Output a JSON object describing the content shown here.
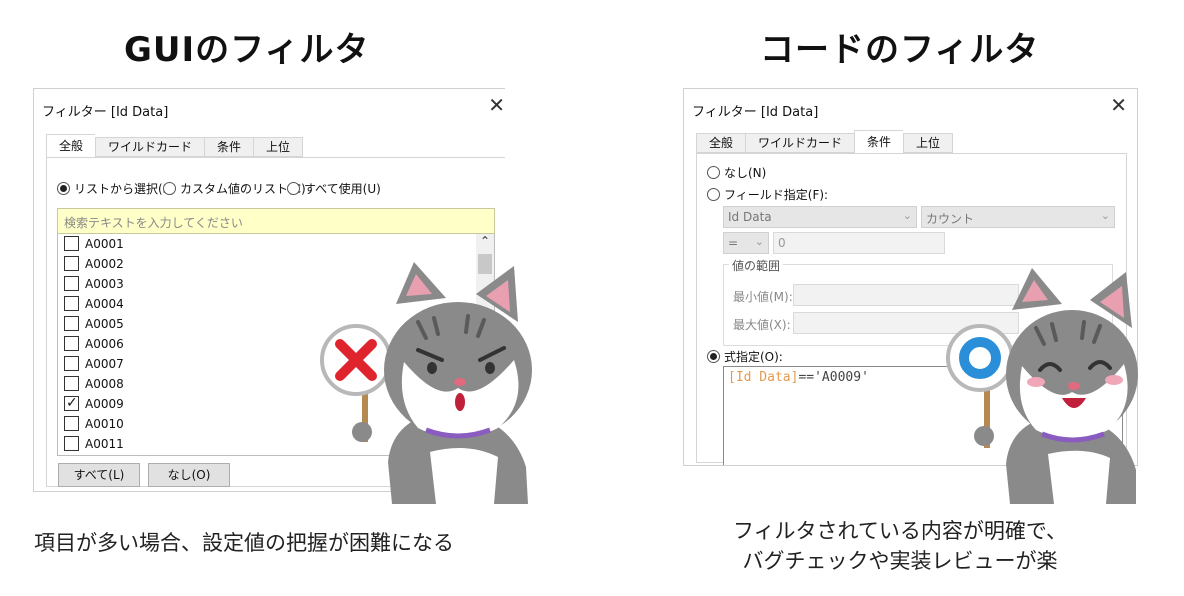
{
  "headings": {
    "left": "GUIのフィルタ",
    "right": "コードのフィルタ"
  },
  "captions": {
    "left": "項目が多い場合、設定値の把握が困難になる",
    "right_line1": "フィルタされている内容が明確で、",
    "right_line2": "バグチェックや実装レビューが楽"
  },
  "dialog_left": {
    "title": "フィルター [Id Data]",
    "close": "✕",
    "tabs": [
      "全般",
      "ワイルドカード",
      "条件",
      "上位"
    ],
    "radios": [
      "リストから選択(S)",
      "カスタム値のリスト(C)",
      "すべて使用(U)"
    ],
    "search_placeholder": "検索テキストを入力してください",
    "items": [
      {
        "label": "A0001",
        "checked": false
      },
      {
        "label": "A0002",
        "checked": false
      },
      {
        "label": "A0003",
        "checked": false
      },
      {
        "label": "A0004",
        "checked": false
      },
      {
        "label": "A0005",
        "checked": false
      },
      {
        "label": "A0006",
        "checked": false
      },
      {
        "label": "A0007",
        "checked": false
      },
      {
        "label": "A0008",
        "checked": false
      },
      {
        "label": "A0009",
        "checked": true
      },
      {
        "label": "A0010",
        "checked": false
      },
      {
        "label": "A0011",
        "checked": false
      }
    ],
    "btn_all": "すべて(L)",
    "btn_none": "なし(O)"
  },
  "dialog_right": {
    "title": "フィルター [Id Data]",
    "close": "✕",
    "tabs": [
      "全般",
      "ワイルドカード",
      "条件",
      "上位"
    ],
    "radio_none": "なし(N)",
    "radio_field": "フィールド指定(F):",
    "field_select": "Id Data",
    "agg_select": "カウント",
    "op_select": "=",
    "value": "0",
    "range_legend": "値の範囲",
    "min_label": "最小値(M):",
    "max_label": "最大値(X):",
    "radio_expr": "式指定(O):",
    "expr_field": "[Id Data]",
    "expr_rest": "=='A0009'"
  },
  "colors": {
    "search_bg": "#ffffc8",
    "expr_field": "#e69a50",
    "x_mark": "#e0242e",
    "o_mark": "#2a8fd8",
    "cat_fur": "#8a8a8a"
  }
}
